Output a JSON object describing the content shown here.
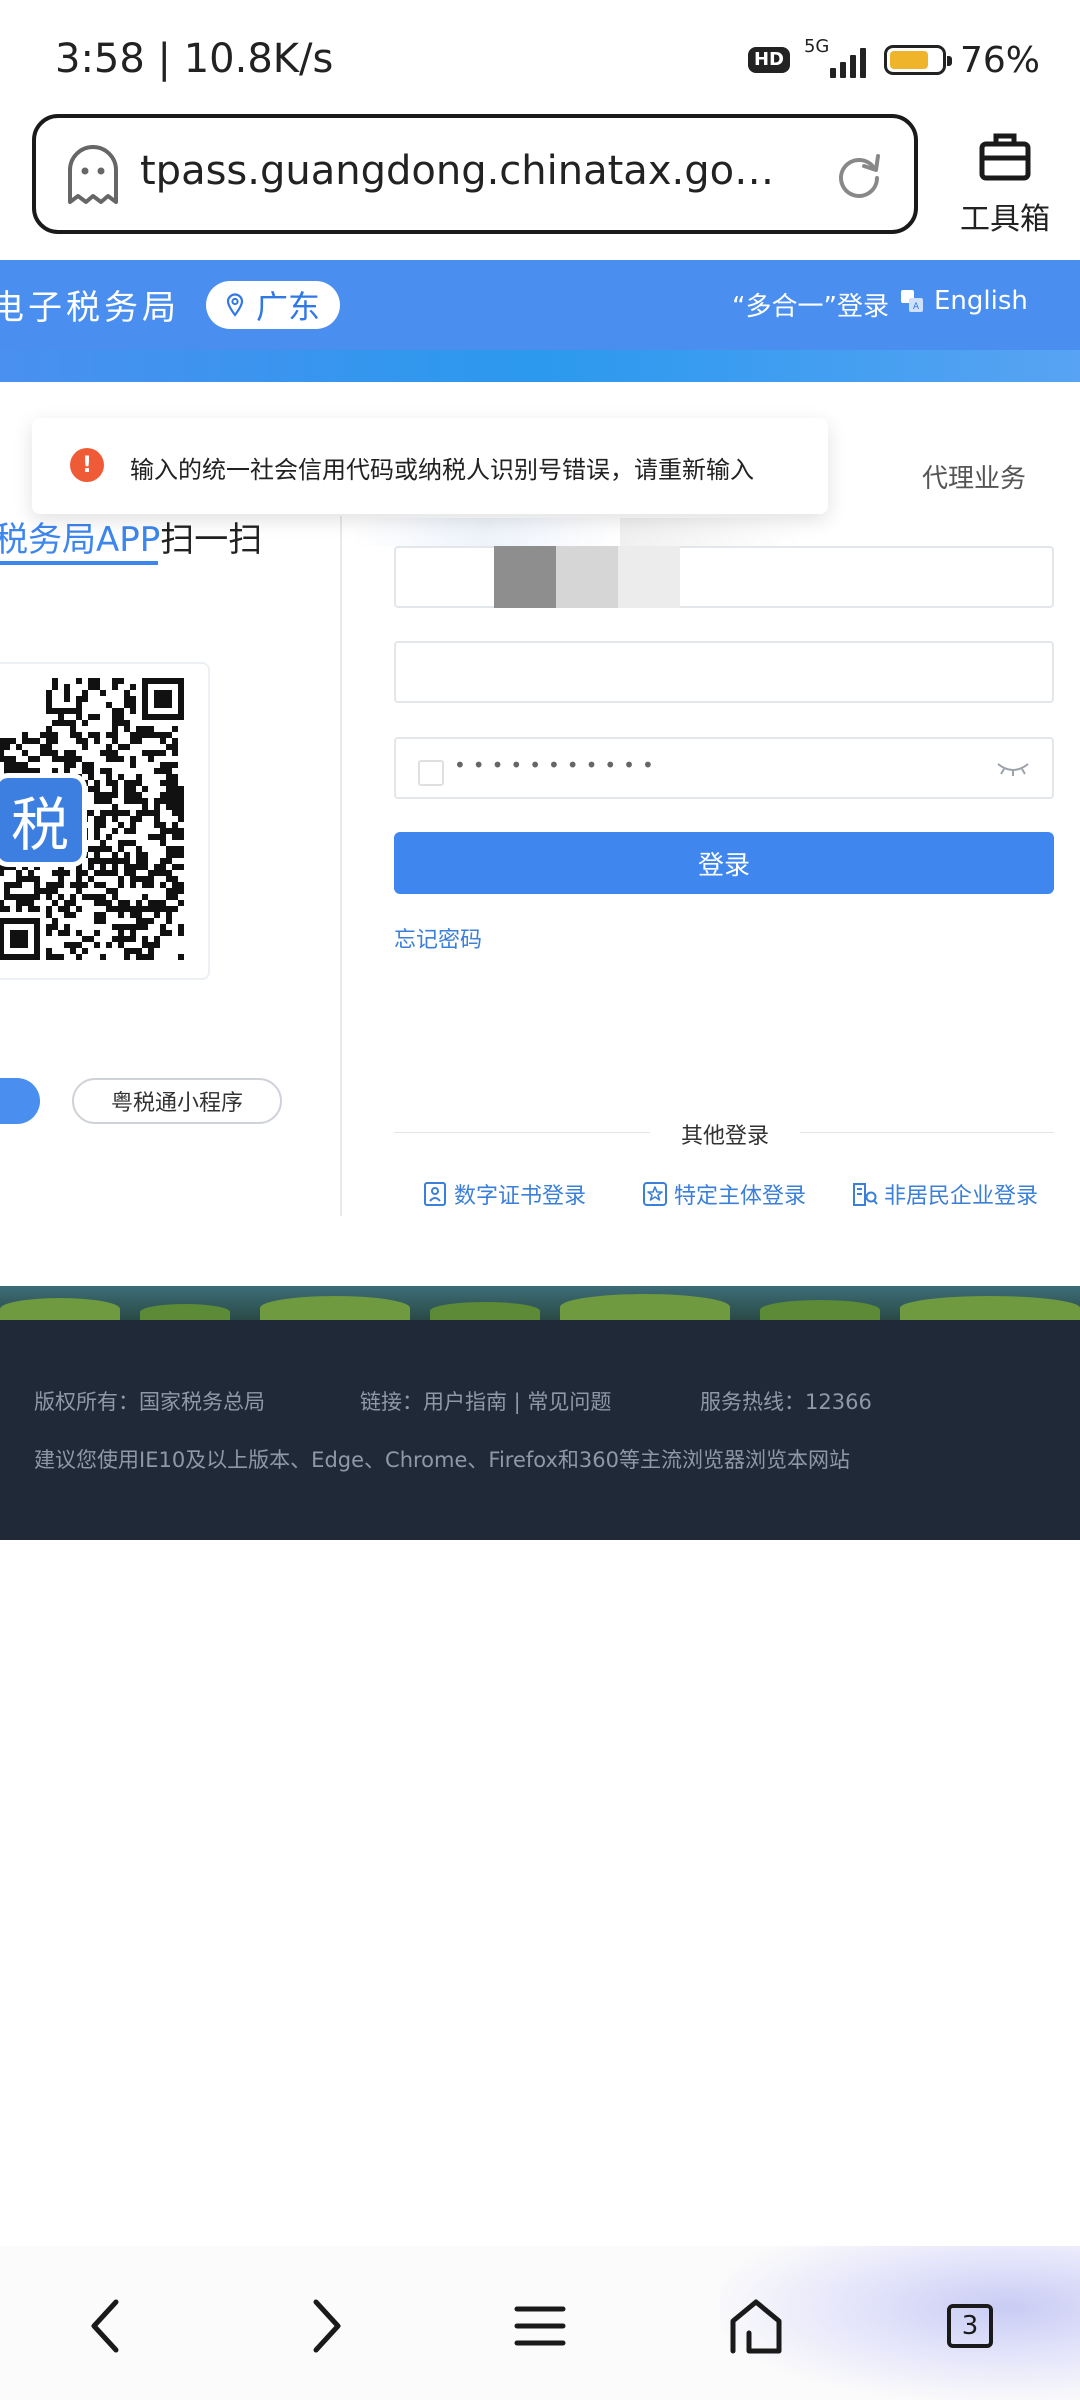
{
  "status_bar": {
    "time": "3:58 | 10.8K/s",
    "hd_badge": "HD",
    "network": "5G",
    "battery_level": 0.76,
    "battery_text": "76%",
    "battery_color": "#f0b42a"
  },
  "browser": {
    "url": "tpass.guangdong.chinatax.gov.cn:...",
    "toolbox_label": "工具箱"
  },
  "header": {
    "title": "电子税务局",
    "region": "广东",
    "multi_login": "“多合一”登录",
    "english": "English",
    "accent_color": "#4a8ef0"
  },
  "toast": {
    "message": "输入的统一社会信用代码或纳税人识别号错误，请重新输入",
    "icon": "error-icon"
  },
  "qr_panel": {
    "title_accent": "税务局APP",
    "title_rest": "扫一扫",
    "logo_char": "税",
    "mini_program": "粤税通小程序"
  },
  "login_form": {
    "tab_agent": "代理业务",
    "password_mask": "•••••••••••",
    "submit": "登录",
    "forgot": "忘记密码",
    "other_login_title": "其他登录",
    "alt_methods": [
      {
        "label": "数字证书登录",
        "icon": "certificate-icon"
      },
      {
        "label": "特定主体登录",
        "icon": "star-badge-icon"
      },
      {
        "label": "非居民企业登录",
        "icon": "building-icon"
      }
    ]
  },
  "footer": {
    "copyright": "版权所有：国家税务总局",
    "links": "链接：用户指南 | 常见问题",
    "hotline": "服务热线：12366",
    "browser_tip": "建议您使用IE10及以上版本、Edge、Chrome、Firefox和360等主流浏览器浏览本网站"
  },
  "bottom_nav": {
    "tab_count": "3"
  }
}
